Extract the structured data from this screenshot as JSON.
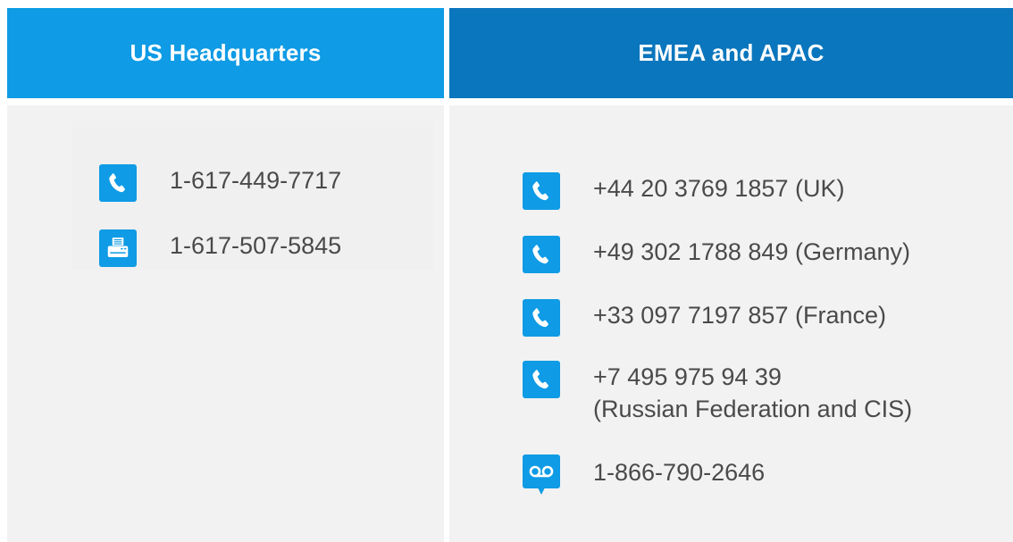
{
  "headers": {
    "left": "US Headquarters",
    "right": "EMEA and APAC"
  },
  "us": {
    "items": [
      {
        "icon": "phone-icon",
        "text": "1-617-449-7717"
      },
      {
        "icon": "fax-icon",
        "text": "1-617-507-5845"
      }
    ]
  },
  "emea": {
    "items": [
      {
        "icon": "phone-icon",
        "text": "+44 20 3769 1857 (UK)"
      },
      {
        "icon": "phone-icon",
        "text": "+49 302 1788 849 (Germany)"
      },
      {
        "icon": "phone-icon",
        "text": "+33 097 7197 857 (France)"
      },
      {
        "icon": "phone-icon",
        "line1": "+7 495 975 94 39",
        "line2": "(Russian Federation and CIS)"
      },
      {
        "icon": "voicemail-icon",
        "text": "1-866-790-2646"
      }
    ]
  },
  "colors": {
    "header_left": "#0f9be5",
    "header_right": "#0a76bd",
    "icon_bg": "#0f9be5",
    "panel_bg": "#f2f2f2",
    "text": "#4a4a4a"
  }
}
